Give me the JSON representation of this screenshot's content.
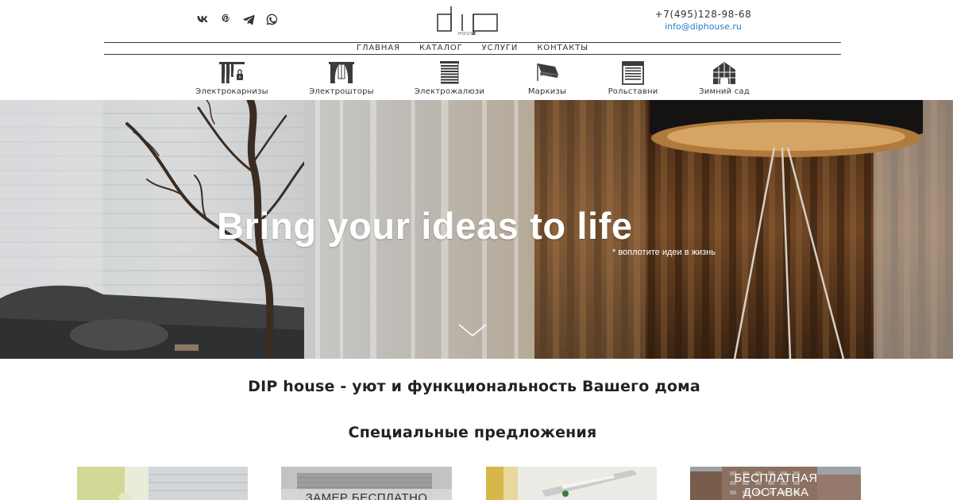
{
  "header": {
    "logo_alt": "DIP house",
    "phone": "+7(495)128-98-68",
    "email": "info@diphouse.ru",
    "socials": [
      {
        "name": "vk-icon",
        "glyph": "vk"
      },
      {
        "name": "pinterest-icon",
        "glyph": "pinterest"
      },
      {
        "name": "telegram-icon",
        "glyph": "telegram"
      },
      {
        "name": "whatsapp-icon",
        "glyph": "whatsapp"
      }
    ]
  },
  "nav": {
    "items": [
      "ГЛАВНАЯ",
      "КАТАЛОГ",
      "УСЛУГИ",
      "КОНТАКТЫ"
    ]
  },
  "categories": [
    {
      "label": "Электрокарнизы",
      "icon": "curtain-rail-icon"
    },
    {
      "label": "Электрошторы",
      "icon": "curtains-icon"
    },
    {
      "label": "Электрожалюзи",
      "icon": "blinds-icon"
    },
    {
      "label": "Маркизы",
      "icon": "awning-icon"
    },
    {
      "label": "Рольставни",
      "icon": "roller-shutter-icon"
    },
    {
      "label": "Зимний сад",
      "icon": "greenhouse-icon"
    }
  ],
  "hero": {
    "title": "Bring your ideas to life",
    "subtitle": "* воплотите идеи в жизнь",
    "scroll_icon": "chevron-down-icon"
  },
  "tagline": "DIP house - уют и функциональность Вашего дома",
  "specials": {
    "title": "Специальные предложения",
    "offers": [
      {
        "text": ""
      },
      {
        "text": "ЗАМЕР БЕСПЛАТНО"
      },
      {
        "text": ""
      },
      {
        "text": "БЕСПЛАТНАЯ ДОСТАВКА"
      }
    ]
  },
  "colors": {
    "link": "#2a7dc4",
    "text": "#222222",
    "icon": "#3b3b3b"
  }
}
